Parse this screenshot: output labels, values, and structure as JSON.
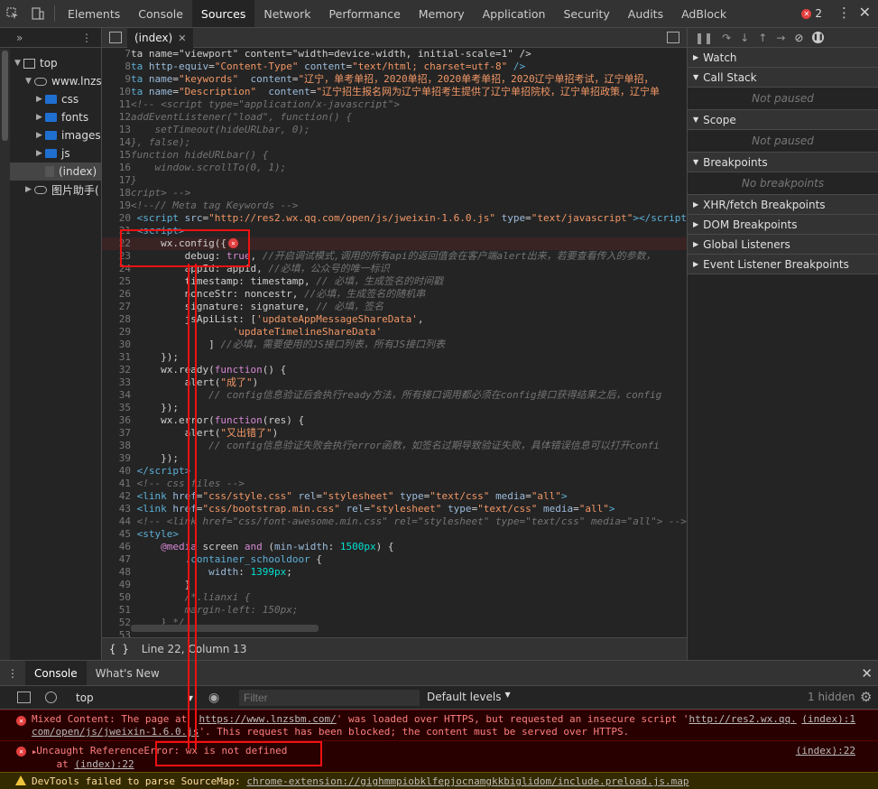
{
  "toolbar": {
    "tabs": [
      "Elements",
      "Console",
      "Sources",
      "Network",
      "Performance",
      "Memory",
      "Application",
      "Security",
      "Audits",
      "AdBlock"
    ],
    "active_tab": "Sources",
    "error_count": "2"
  },
  "navigator": {
    "nodes": [
      {
        "label": "top",
        "icon": "frame-icon"
      },
      {
        "label": "www.lnzsl",
        "icon": "cloud-icon"
      },
      {
        "label": "css",
        "icon": "folder-icon"
      },
      {
        "label": "fonts",
        "icon": "folder-icon"
      },
      {
        "label": "images",
        "icon": "folder-icon"
      },
      {
        "label": "js",
        "icon": "folder-icon"
      },
      {
        "label": "(index)",
        "icon": "file-icon"
      },
      {
        "label": "图片助手(",
        "icon": "cloud-icon"
      }
    ]
  },
  "editor": {
    "tab_label": "(index)",
    "highlight_line": 22,
    "lines": [
      {
        "n": "7",
        "html": "ta name=\"viewport\" content=\"width=device-width, initial-scale=1\" />"
      },
      {
        "n": "8",
        "html": "<span class=\"c-tag\">ta</span> <span class=\"c-at\">http-equiv</span>=<span class=\"c-str\">\"Content-Type\"</span> <span class=\"c-at\">content</span>=<span class=\"c-str\">\"text/html; charset=utf-8\"</span> <span class=\"c-tag\">/></span>"
      },
      {
        "n": "9",
        "html": "<span class=\"c-tag\">ta</span> <span class=\"c-at\">name</span>=<span class=\"c-str\">\"keywords\"</span>  <span class=\"c-at\">content</span>=<span class=\"c-str\">\"辽宁，单考单招，2020单招，2020单考单招，2020辽宁单招考试，辽宁单招，</span>"
      },
      {
        "n": "10",
        "html": "<span class=\"c-tag\">ta</span> <span class=\"c-at\">name</span>=<span class=\"c-str\">\"Description\"</span>  <span class=\"c-at\">content</span>=<span class=\"c-str\">\"辽宁招生报名网为辽宁单招考生提供了辽宁单招院校，辽宁单招政策，辽宁单</span>"
      },
      {
        "n": "11",
        "html": "<span class=\"c-cm\">&lt;!-- &lt;script type=\"application/x-javascript\"></span>"
      },
      {
        "n": "12",
        "html": "<span class=\"c-cm\">addEventListener(\"load\", function() {</span>"
      },
      {
        "n": "13",
        "html": "<span class=\"c-cm\">    setTimeout(hideURLbar, 0);</span>"
      },
      {
        "n": "14",
        "html": "<span class=\"c-cm\">}, false);</span>"
      },
      {
        "n": "15",
        "html": "<span class=\"c-cm\">function hideURLbar() {</span>"
      },
      {
        "n": "16",
        "html": "<span class=\"c-cm\">    window.scrollTo(0, 1);</span>"
      },
      {
        "n": "17",
        "html": "<span class=\"c-cm\">}</span>"
      },
      {
        "n": "18",
        "html": "<span class=\"c-cm\">cript> --></span>"
      },
      {
        "n": "19",
        "html": "<span class=\"c-cm\">&lt;!--// Meta tag Keywords --></span>"
      },
      {
        "n": "20",
        "html": " <span class=\"c-tag\">&lt;script</span> <span class=\"c-at\">src</span>=<span class=\"c-str\">\"http://res2.wx.qq.com/open/js/jweixin-1.6.0.js\"</span> <span class=\"c-at\">type</span>=<span class=\"c-str\">\"text/javascript\"</span><span class=\"c-tag\">>&lt;/script</span>"
      },
      {
        "n": "21",
        "html": " <span class=\"c-tag\">&lt;script></span>"
      },
      {
        "n": "22",
        "html": "     wx.config({"
      },
      {
        "n": "23",
        "html": "         debug: <span class=\"c-kw\">true</span>, <span class=\"c-cm\">//开启调试模式,调用的所有api的返回值会在客户端alert出来，若要查看传入的参数，</span>"
      },
      {
        "n": "24",
        "html": "         appId: appid, <span class=\"c-cm\">//必填，公众号的唯一标识</span>"
      },
      {
        "n": "25",
        "html": "         timestamp: timestamp, <span class=\"c-cm\">// 必填，生成签名的时间戳</span>"
      },
      {
        "n": "26",
        "html": "         nonceStr: noncestr, <span class=\"c-cm\">//必填，生成签名的随机串</span>"
      },
      {
        "n": "27",
        "html": "         signature: signature, <span class=\"c-cm\">// 必填，签名</span>"
      },
      {
        "n": "28",
        "html": "         jsApiList: [<span class=\"c-str\">'updateAppMessageShareData'</span>,"
      },
      {
        "n": "29",
        "html": "                 <span class=\"c-str\">'updateTimelineShareData'</span>"
      },
      {
        "n": "30",
        "html": "             ] <span class=\"c-cm\">//必填，需要使用的JS接口列表，所有JS接口列表</span>"
      },
      {
        "n": "31",
        "html": "     });"
      },
      {
        "n": "32",
        "html": "     wx.ready(<span class=\"c-kw\">function</span>() {"
      },
      {
        "n": "33",
        "html": "         alert(<span class=\"c-str\">\"成了\"</span>)"
      },
      {
        "n": "34",
        "html": "             <span class=\"c-cm\">// config信息验证后会执行ready方法，所有接口调用都必须在config接口获得结果之后，config</span>"
      },
      {
        "n": "35",
        "html": "     });"
      },
      {
        "n": "36",
        "html": "     wx.error(<span class=\"c-kw\">function</span>(res) {"
      },
      {
        "n": "37",
        "html": "         alert(<span class=\"c-str\">\"又出错了\"</span>)"
      },
      {
        "n": "38",
        "html": "             <span class=\"c-cm\">// config信息验证失败会执行error函数，如签名过期导致验证失败，具体错误信息可以打开confi</span>"
      },
      {
        "n": "39",
        "html": "     });"
      },
      {
        "n": "40",
        "html": " <span class=\"c-tag\">&lt;/script></span>"
      },
      {
        "n": "41",
        "html": " <span class=\"c-cm\">&lt;!-- css files --></span>"
      },
      {
        "n": "42",
        "html": " <span class=\"c-tag\">&lt;link</span> <span class=\"c-at\">href</span>=<span class=\"c-str\">\"css/style.css\"</span> <span class=\"c-at\">rel</span>=<span class=\"c-str\">\"stylesheet\"</span> <span class=\"c-at\">type</span>=<span class=\"c-str\">\"text/css\"</span> <span class=\"c-at\">media</span>=<span class=\"c-str\">\"all\"</span><span class=\"c-tag\">></span>"
      },
      {
        "n": "43",
        "html": " <span class=\"c-tag\">&lt;link</span> <span class=\"c-at\">href</span>=<span class=\"c-str\">\"css/bootstrap.min.css\"</span> <span class=\"c-at\">rel</span>=<span class=\"c-str\">\"stylesheet\"</span> <span class=\"c-at\">type</span>=<span class=\"c-str\">\"text/css\"</span> <span class=\"c-at\">media</span>=<span class=\"c-str\">\"all\"</span><span class=\"c-tag\">></span>"
      },
      {
        "n": "44",
        "html": " <span class=\"c-cm\">&lt;!-- &lt;link href=\"css/font-awesome.min.css\" rel=\"stylesheet\" type=\"text/css\" media=\"all\"> --></span>"
      },
      {
        "n": "45",
        "html": " <span class=\"c-tag\">&lt;style></span>"
      },
      {
        "n": "46",
        "html": "     <span class=\"c-kw\">@media</span> screen <span class=\"c-kw\">and</span> (<span class=\"c-at\">min-width</span>: <span class=\"c-num\">1500px</span>) {"
      },
      {
        "n": "47",
        "html": "         <span class=\"c-tag\">.container_schooldoor</span> {"
      },
      {
        "n": "48",
        "html": "             <span class=\"c-at\">width</span>: <span class=\"c-num\">1399px</span>;"
      },
      {
        "n": "49",
        "html": "         }"
      },
      {
        "n": "50",
        "html": "         <span class=\"c-cm\">/*.lianxi {</span>"
      },
      {
        "n": "51",
        "html": "         <span class=\"c-cm\">margin-left: 150px;</span>"
      },
      {
        "n": "52",
        "html": "     <span class=\"c-cm\">} */</span>"
      },
      {
        "n": "53",
        "html": ""
      }
    ],
    "status": "Line 22, Column 13"
  },
  "sidebar": {
    "sections": [
      {
        "title": "Watch",
        "body": null
      },
      {
        "title": "Call Stack",
        "body": "Not paused"
      },
      {
        "title": "Scope",
        "body": "Not paused"
      },
      {
        "title": "Breakpoints",
        "body": "No breakpoints"
      },
      {
        "title": "XHR/fetch Breakpoints",
        "body": null
      },
      {
        "title": "DOM Breakpoints",
        "body": null
      },
      {
        "title": "Global Listeners",
        "body": null
      },
      {
        "title": "Event Listener Breakpoints",
        "body": null
      }
    ]
  },
  "console": {
    "tabs": [
      "Console",
      "What's New"
    ],
    "context": "top",
    "filter_placeholder": "Filter",
    "levels": "Default levels",
    "hidden": "1 hidden",
    "messages": [
      {
        "type": "error",
        "text_a": "Mixed Content: The page at '",
        "link_a": "https://www.lnzsbm.com/",
        "text_b": "' was loaded over HTTPS, but requested an insecure script '",
        "link_b": "http://res2.wx.qq.",
        "line2_link": "com/open/js/jweixin-1.6.0.js",
        "line2_text": "'. This request has been blocked; the content must be served over HTTPS.",
        "source": "(index):1"
      },
      {
        "type": "error",
        "text_a": "Uncaught ReferenceError: wx is not defined",
        "line2_text": "    at ",
        "line2_link": "(index):22",
        "source": "(index):22"
      },
      {
        "type": "warning",
        "text_a": "DevTools failed to parse SourceMap: ",
        "link_a": "chrome-extension://gighmmpiobklfepjocnamgkkbiglidom/include.preload.js.map"
      }
    ]
  }
}
